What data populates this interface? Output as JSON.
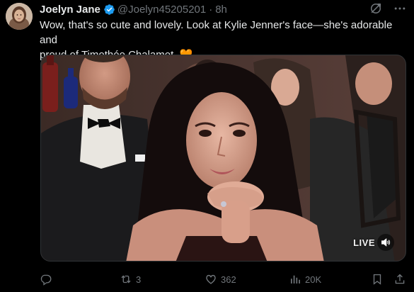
{
  "post": {
    "author": {
      "display_name": "Joelyn Jane",
      "handle": "@Joelyn45205201",
      "separator": "·",
      "time": "8h",
      "verified": true,
      "verified_color": "#1d9bf0"
    },
    "text_line1": "Wow, that's so cute and lovely. Look at Kylie Jenner's face—she's adorable and",
    "text_line2": "proud of Timothée Chalamet. 🧡",
    "media": {
      "badge": "LIVE",
      "volume_icon": "speaker-icon"
    },
    "stats": {
      "replies": "",
      "reposts": "3",
      "likes": "362",
      "views": "20K"
    }
  },
  "icons": {
    "header": [
      "grok-icon",
      "more-icon"
    ],
    "actions": [
      "reply-icon",
      "repost-icon",
      "like-icon",
      "views-icon",
      "bookmark-icon",
      "share-icon"
    ]
  },
  "colors": {
    "background": "#000000",
    "text_primary": "#e7e9ea",
    "text_secondary": "#71767b",
    "border": "#2f3336",
    "accent": "#1d9bf0"
  }
}
